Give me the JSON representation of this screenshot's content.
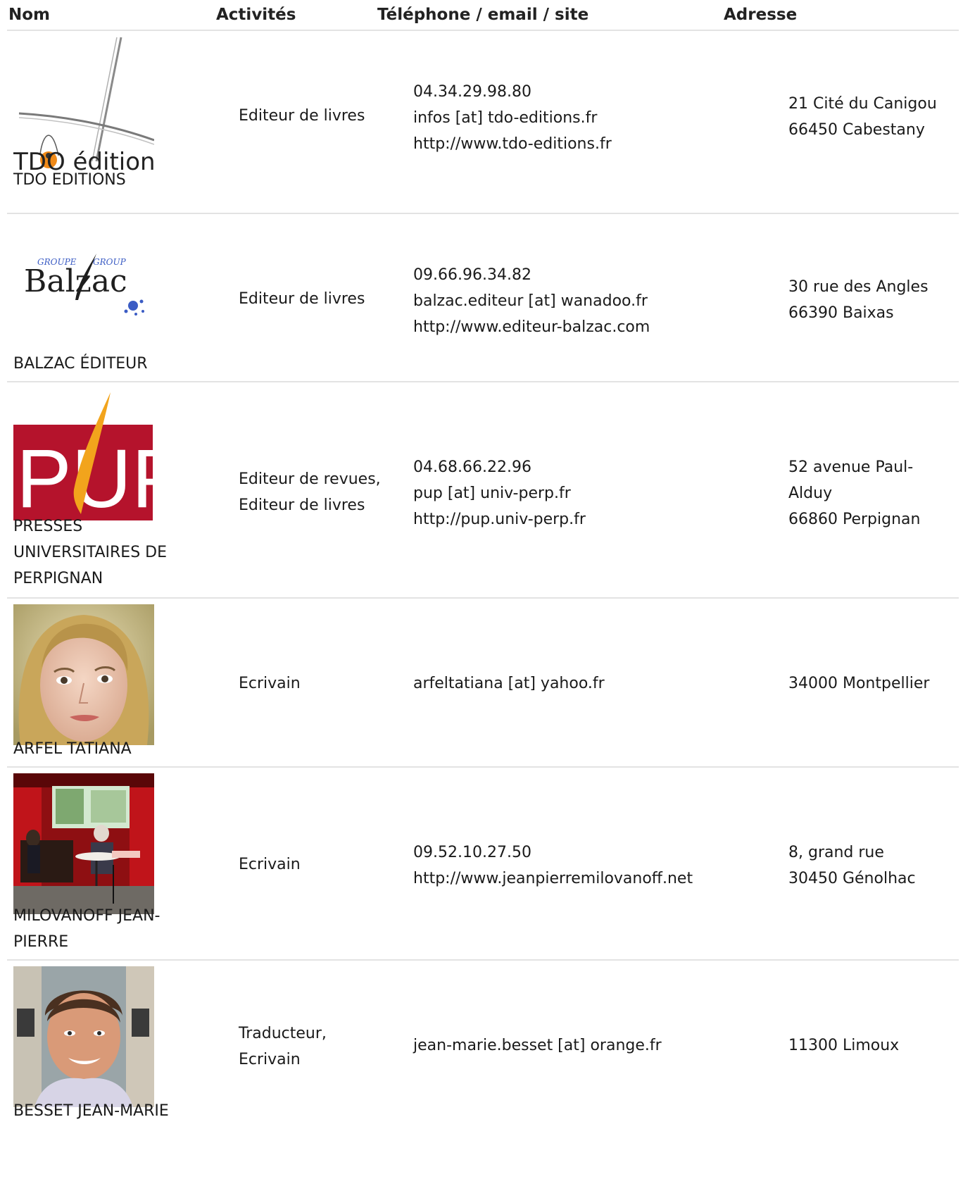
{
  "headers": {
    "name": "Nom",
    "activities": "Activités",
    "contact": "Téléphone / email / site",
    "address": "Adresse"
  },
  "rows": [
    {
      "logo_text": "TDO éditions",
      "name": "TDO EDITIONS",
      "activities": [
        "Editeur de livres"
      ],
      "contact": [
        "04.34.29.98.80",
        "infos [at] tdo-editions.fr",
        "http://www.tdo-editions.fr"
      ],
      "address": [
        "21 Cité du Canigou",
        "66450 Cabestany"
      ]
    },
    {
      "logo_text": {
        "group_left": "GROUPE",
        "group_right": "GROUP",
        "main": "Balzac"
      },
      "name": "BALZAC ÉDITEUR",
      "activities": [
        "Editeur de livres"
      ],
      "contact": [
        "09.66.96.34.82",
        "balzac.editeur [at] wanadoo.fr",
        "http://www.editeur-balzac.com"
      ],
      "address": [
        "30 rue des Angles",
        "66390 Baixas"
      ]
    },
    {
      "logo_text": "PUP",
      "name": "PRESSES UNIVERSITAIRES DE PERPIGNAN",
      "activities": [
        "Editeur de revues,",
        "Editeur de livres"
      ],
      "contact": [
        "04.68.66.22.96",
        "pup [at] univ-perp.fr",
        "http://pup.univ-perp.fr"
      ],
      "address": [
        "52 avenue Paul-",
        "Alduy",
        "66860 Perpignan"
      ]
    },
    {
      "name": "ARFEL TATIANA",
      "activities": [
        "Ecrivain"
      ],
      "contact": [
        "arfeltatiana [at] yahoo.fr"
      ],
      "address": [
        "34000 Montpellier"
      ]
    },
    {
      "name": "MILOVANOFF JEAN-PIERRE",
      "activities": [
        "Ecrivain"
      ],
      "contact": [
        "09.52.10.27.50",
        "http://www.jeanpierremilovanoff.net"
      ],
      "address": [
        "8, grand rue",
        "30450 Génolhac"
      ]
    },
    {
      "name": "BESSET JEAN-MARIE",
      "activities": [
        "Traducteur,",
        "Ecrivain"
      ],
      "contact": [
        "jean-marie.besset [at] orange.fr"
      ],
      "address": [
        "11300 Limoux"
      ]
    }
  ],
  "colors": {
    "divider": "#e3e3e3",
    "pup_red": "#b5132c",
    "pup_orange": "#f2a41c",
    "balzac_blue": "#3b5cc4",
    "tdo_orange": "#f08a18"
  }
}
